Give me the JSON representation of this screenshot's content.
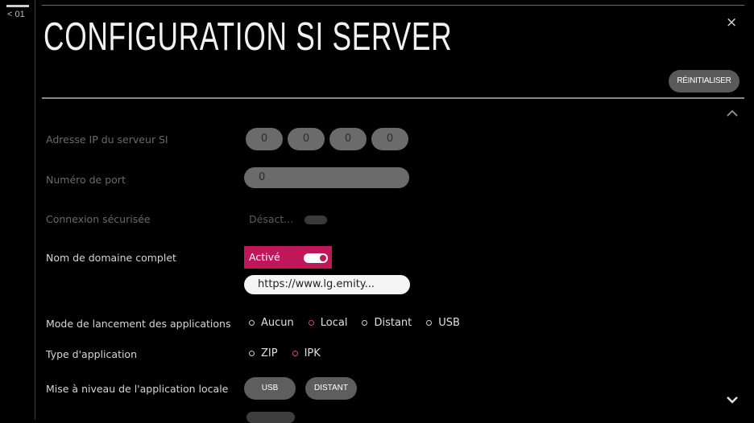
{
  "nav": {
    "back_label": "< 01"
  },
  "header": {
    "title": "CONFIGURATION SI SERVER",
    "reset_label": "RÉINITIALISER",
    "close_glyph": "×"
  },
  "rows": {
    "ip": {
      "label": "Adresse IP du serveur SI",
      "octets": [
        "0",
        "0",
        "0",
        "0"
      ]
    },
    "port": {
      "label": "Numéro de port",
      "value": "0"
    },
    "secure": {
      "label": "Connexion sécurisée",
      "value": "Désact..."
    },
    "fqdn": {
      "label": "Nom de domaine complet",
      "value": "Activé",
      "url": "https://www.lg.emity..."
    },
    "launch_mode": {
      "label": "Mode de lancement des applications",
      "options": [
        "Aucun",
        "Local",
        "Distant",
        "USB"
      ],
      "selected": "Local"
    },
    "app_type": {
      "label": "Type d'application",
      "options": [
        "ZIP",
        "IPK"
      ],
      "selected": "IPK"
    },
    "upgrade": {
      "label": "Mise à niveau de l'application locale",
      "buttons": [
        "USB",
        "DISTANT"
      ]
    }
  },
  "icons": {
    "scroll_up": "chevron-up-icon",
    "scroll_down": "chevron-down-icon",
    "close": "close-icon"
  },
  "colors": {
    "accent": "#c0175b",
    "selected_radio": "#e3407c"
  }
}
